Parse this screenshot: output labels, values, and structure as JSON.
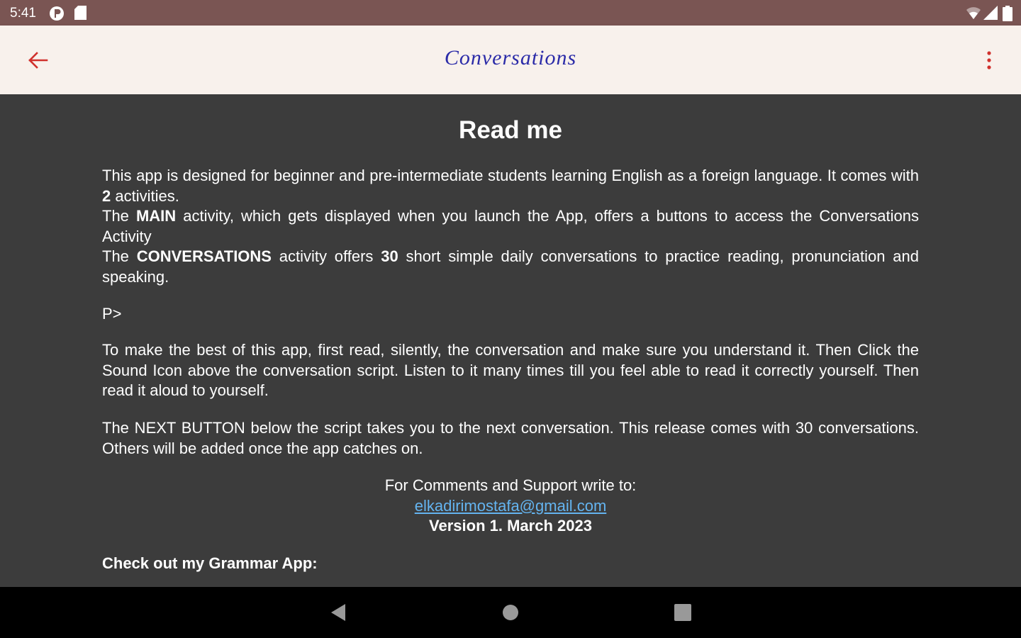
{
  "status_bar": {
    "time": "5:41",
    "left_icons": [
      "p-badge-icon",
      "sd-card-icon"
    ],
    "right_icons": [
      "wifi-icon",
      "cell-signal-icon",
      "battery-icon"
    ]
  },
  "app_bar": {
    "title": "Conversations",
    "back_icon": "arrow-left-icon",
    "menu_icon": "more-vert-icon",
    "accent_color": "#d0312d",
    "title_color": "#2b2ba8",
    "background_color": "#f8f1ec"
  },
  "readme": {
    "heading": "Read me",
    "intro": {
      "p1": "This app is designed for beginner and pre-intermediate students learning English as a foreign language. It comes with ",
      "count": "2",
      "p1_end": " activities.",
      "the1": "The ",
      "main_label": "MAIN",
      "main_desc": " activity, which gets displayed when you launch the App, offers a buttons to access the Conversations Activity",
      "the2": "The ",
      "conv_label": "CONVERSATIONS",
      "conv_desc1": " activity offers ",
      "conv_count": "30",
      "conv_desc2": " short simple daily conversations to practice reading, pronunciation and speaking."
    },
    "p_tag": "P>",
    "paragraph2": "To make the best of this app, first read, silently, the conversation and make sure you understand it. Then Click the Sound Icon above the conversation script. Listen to it many times till you feel able to read it correctly yourself. Then read it aloud to yourself.",
    "paragraph3": "The NEXT BUTTON below the script takes you to the next conversation. This release comes with 30 conversations. Others will be added once the app catches on.",
    "support_text": "For Comments and Support write to:",
    "email": "elkadirimostafa@gmail.com",
    "version": "Version 1. March 2023",
    "grammar_promo": "Check out my Grammar App:",
    "link_color": "#64b4f0",
    "background_color": "#3c3c3c"
  },
  "nav_bar": {
    "back_icon": "nav-back-triangle-icon",
    "home_icon": "nav-home-circle-icon",
    "recents_icon": "nav-recents-square-icon"
  }
}
